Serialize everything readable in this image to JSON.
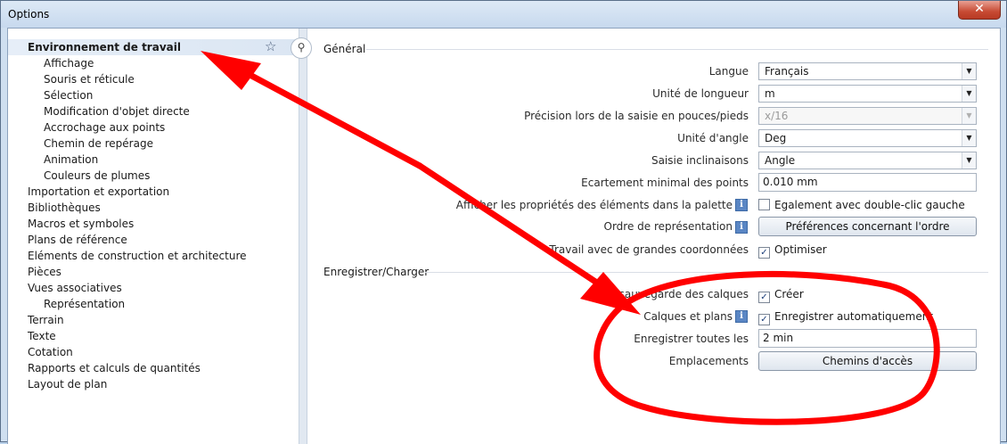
{
  "window": {
    "title": "Options",
    "close_glyph": "✕"
  },
  "tree": {
    "items": [
      {
        "label": "Environnement de travail",
        "level": 0,
        "selected": true
      },
      {
        "label": "Affichage",
        "level": 1
      },
      {
        "label": "Souris et réticule",
        "level": 1
      },
      {
        "label": "Sélection",
        "level": 1
      },
      {
        "label": "Modification d'objet directe",
        "level": 1
      },
      {
        "label": "Accrochage aux points",
        "level": 1
      },
      {
        "label": "Chemin de repérage",
        "level": 1
      },
      {
        "label": "Animation",
        "level": 1
      },
      {
        "label": "Couleurs de plumes",
        "level": 1
      },
      {
        "label": "Importation et exportation",
        "level": 0
      },
      {
        "label": "Bibliothèques",
        "level": 0
      },
      {
        "label": "Macros et symboles",
        "level": 0
      },
      {
        "label": "Plans de référence",
        "level": 0
      },
      {
        "label": "Eléments de construction et architecture",
        "level": 0
      },
      {
        "label": "Pièces",
        "level": 0
      },
      {
        "label": "Vues associatives",
        "level": 0
      },
      {
        "label": "Représentation",
        "level": 1
      },
      {
        "label": "Terrain",
        "level": 0
      },
      {
        "label": "Texte",
        "level": 0
      },
      {
        "label": "Cotation",
        "level": 0
      },
      {
        "label": "Rapports et calculs de quantités",
        "level": 0
      },
      {
        "label": "Layout de plan",
        "level": 0
      }
    ],
    "favorite_icon": "star-arrow-icon",
    "search_icon": "magnifier-icon"
  },
  "general": {
    "title": "Général",
    "langue": {
      "label": "Langue",
      "value": "Français"
    },
    "unite_longueur": {
      "label": "Unité de longueur",
      "value": "m"
    },
    "precision": {
      "label": "Précision lors de la saisie en pouces/pieds",
      "value": "x/16"
    },
    "unite_angle": {
      "label": "Unité d'angle",
      "value": "Deg"
    },
    "saisie_inclinaisons": {
      "label": "Saisie inclinaisons",
      "value": "Angle"
    },
    "ecartement": {
      "label": "Ecartement minimal des points",
      "value": "0.010 mm"
    },
    "afficher_proprietes": {
      "label": "Afficher les propriétés des éléments dans la palette",
      "check_label": "Egalement avec double-clic gauche",
      "checked": false
    },
    "ordre": {
      "label": "Ordre de représentation",
      "button": "Préférences concernant l'ordre"
    },
    "coordonnees": {
      "label": "Travail avec de grandes coordonnées",
      "check_label": "Optimiser",
      "checked": true
    }
  },
  "save_load": {
    "title": "Enregistrer/Charger",
    "sauvegarde": {
      "label": "...sauvegarde des calques",
      "check_label": "Créer",
      "checked": true
    },
    "calques_plans": {
      "label": "Calques et plans",
      "check_label": "Enregistrer automatiquement",
      "checked": true
    },
    "enregistrer_toutes": {
      "label": "Enregistrer toutes les",
      "value": "2 min"
    },
    "emplacements": {
      "label": "Emplacements",
      "button": "Chemins d'accès"
    }
  },
  "glyphs": {
    "dropdown": "▼",
    "check": "✓",
    "info": "i",
    "star": "☆",
    "search": "⚲"
  },
  "colors": {
    "annotation_red": "#ff0000",
    "selection": "#dbe6f3"
  }
}
